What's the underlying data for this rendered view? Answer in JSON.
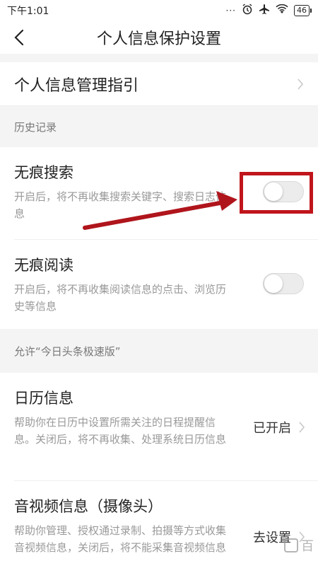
{
  "status_bar": {
    "time": "下午1:01",
    "signal_dots": "···",
    "battery": "46"
  },
  "nav": {
    "title": "个人信息保护设置"
  },
  "management_guide": {
    "label": "个人信息管理指引"
  },
  "section_history": {
    "header": "历史记录",
    "items": [
      {
        "title": "无痕搜索",
        "desc": "开启后，将不再收集搜索关键字、搜索日志信息",
        "toggle_on": false
      },
      {
        "title": "无痕阅读",
        "desc": "开启后，将不再收集阅读信息的点击、浏览历史等信息",
        "toggle_on": false
      }
    ]
  },
  "section_allow": {
    "header": "允许“今日头条极速版”",
    "items": [
      {
        "title": "日历信息",
        "desc": "帮助你在日历中设置所需关注的日程提醒信息。关闭后，将不再收集、处理系统日历信息",
        "value": "已开启"
      },
      {
        "title": "音视频信息（摄像头）",
        "desc": "帮助你管理、授权通过录制、拍摄等方式收集音视频信息，关闭后，将不能采集音视频信息",
        "value": "去设置"
      }
    ]
  },
  "annotation": {
    "box_color": "#c0151c",
    "arrow_color": "#b0151c"
  },
  "watermark": {
    "text": "百"
  }
}
